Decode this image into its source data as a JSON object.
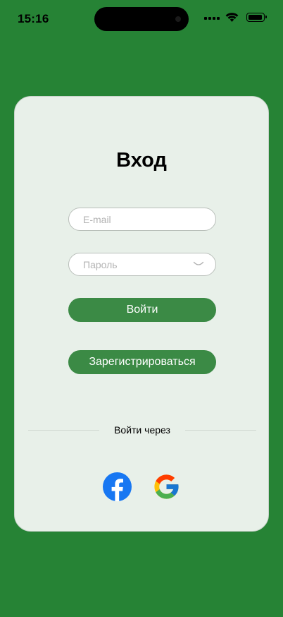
{
  "status_bar": {
    "time": "15:16",
    "icons": [
      "cellular-icon",
      "wifi-icon",
      "battery-icon"
    ]
  },
  "login": {
    "title": "Вход",
    "email_placeholder": "E-mail",
    "password_placeholder": "Пароль",
    "login_button": "Войти",
    "register_button": "Зарегистрироваться",
    "divider_label": "Войти через",
    "social": [
      "facebook-icon",
      "google-icon"
    ]
  },
  "colors": {
    "background": "#268335",
    "card": "#e8f0e9",
    "button": "#3b8a45",
    "facebook": "#1877f2"
  }
}
